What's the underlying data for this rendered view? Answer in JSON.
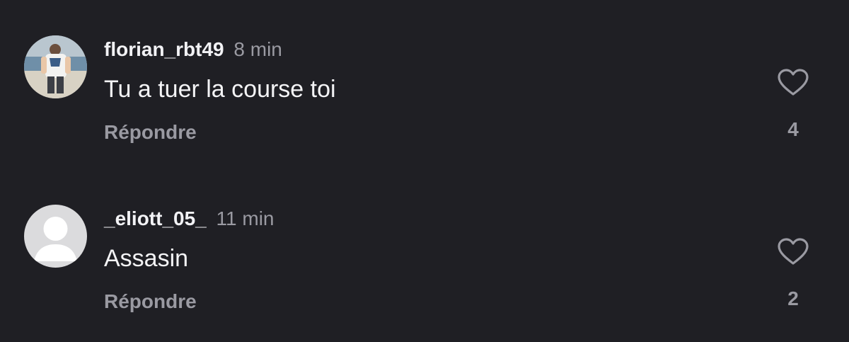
{
  "comments": [
    {
      "username": "florian_rbt49",
      "time": "8 min",
      "text": "Tu a tuer la course toi",
      "reply_label": "Répondre",
      "likes": "4",
      "avatar": "photo-avatar"
    },
    {
      "username": "_eliott_05_",
      "time": "11 min",
      "text": "Assasin",
      "reply_label": "Répondre",
      "likes": "2",
      "avatar": "default-avatar"
    }
  ],
  "icons": {
    "like": "heart-outline-icon"
  },
  "colors": {
    "background": "#1f1f24",
    "primary_text": "#f4f4f6",
    "secondary_text": "#9a9aa2"
  }
}
